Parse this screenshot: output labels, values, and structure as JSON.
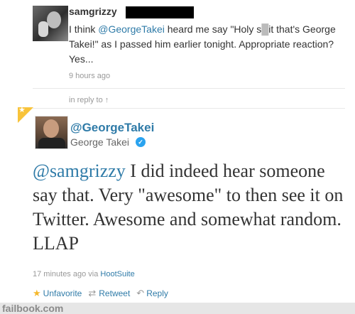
{
  "original_tweet": {
    "username": "samgrizzy",
    "text_before": "I think ",
    "mention": "@GeorgeTakei",
    "text_mid1": " heard me say \"Holy s",
    "censor": "█",
    "text_after": "it that's George Takei!\" as I passed him earlier tonight. Appropriate reaction? Yes...",
    "timestamp": "9 hours ago"
  },
  "in_reply_to": "in reply to ↑",
  "reply_tweet": {
    "handle": "@GeorgeTakei",
    "full_name": "George Takei",
    "mention": "@samgrizzy",
    "text": " I did indeed hear someone say that. Very \"awesome\" to then see it on Twitter. Awesome and somewhat random. LLAP",
    "time": "17 minutes ago",
    "via_label": "via",
    "via_app": "HootSuite"
  },
  "actions": {
    "unfavorite": "Unfavorite",
    "retweet": "Retweet",
    "reply": "Reply"
  },
  "icons": {
    "favorite": "star-icon",
    "retweet": "retweet-icon",
    "reply": "reply-icon",
    "verified": "verified-icon"
  },
  "colors": {
    "link": "#2f7ba8",
    "favorite_star": "#f5b82c",
    "verified": "#2aa3ef"
  },
  "footer": "failbook.com"
}
